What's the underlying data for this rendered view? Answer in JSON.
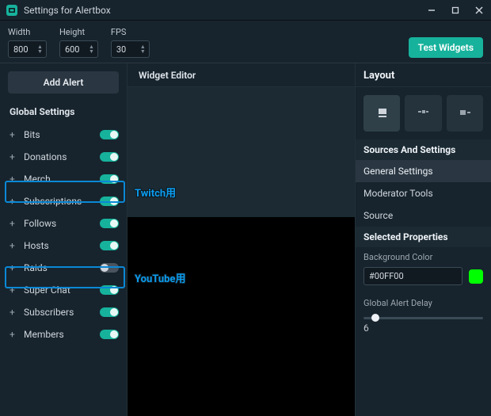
{
  "titlebar": {
    "title": "Settings for Alertbox"
  },
  "top": {
    "width_label": "Width",
    "width_value": "800",
    "height_label": "Height",
    "height_value": "600",
    "fps_label": "FPS",
    "fps_value": "30",
    "test_label": "Test Widgets"
  },
  "sidebar": {
    "add_label": "Add Alert",
    "section": "Global Settings",
    "items": [
      {
        "label": "Bits",
        "on": true
      },
      {
        "label": "Donations",
        "on": true
      },
      {
        "label": "Merch",
        "on": true
      },
      {
        "label": "Subscriptions",
        "on": true
      },
      {
        "label": "Follows",
        "on": true
      },
      {
        "label": "Hosts",
        "on": true
      },
      {
        "label": "Raids",
        "on": false
      },
      {
        "label": "Super Chat",
        "on": true
      },
      {
        "label": "Subscribers",
        "on": true
      },
      {
        "label": "Members",
        "on": true
      }
    ]
  },
  "editor": {
    "tab": "Widget Editor"
  },
  "right": {
    "layout_h": "Layout",
    "sources_h": "Sources And Settings",
    "sources": [
      "General Settings",
      "Moderator Tools",
      "Source"
    ],
    "selected_h": "Selected Properties",
    "bg_label": "Background Color",
    "bg_hex": "#00FF00",
    "delay_label": "Global Alert Delay",
    "delay_value": "6"
  },
  "annotations": {
    "twitch": "Twitch用",
    "youtube": "YouTube用"
  }
}
